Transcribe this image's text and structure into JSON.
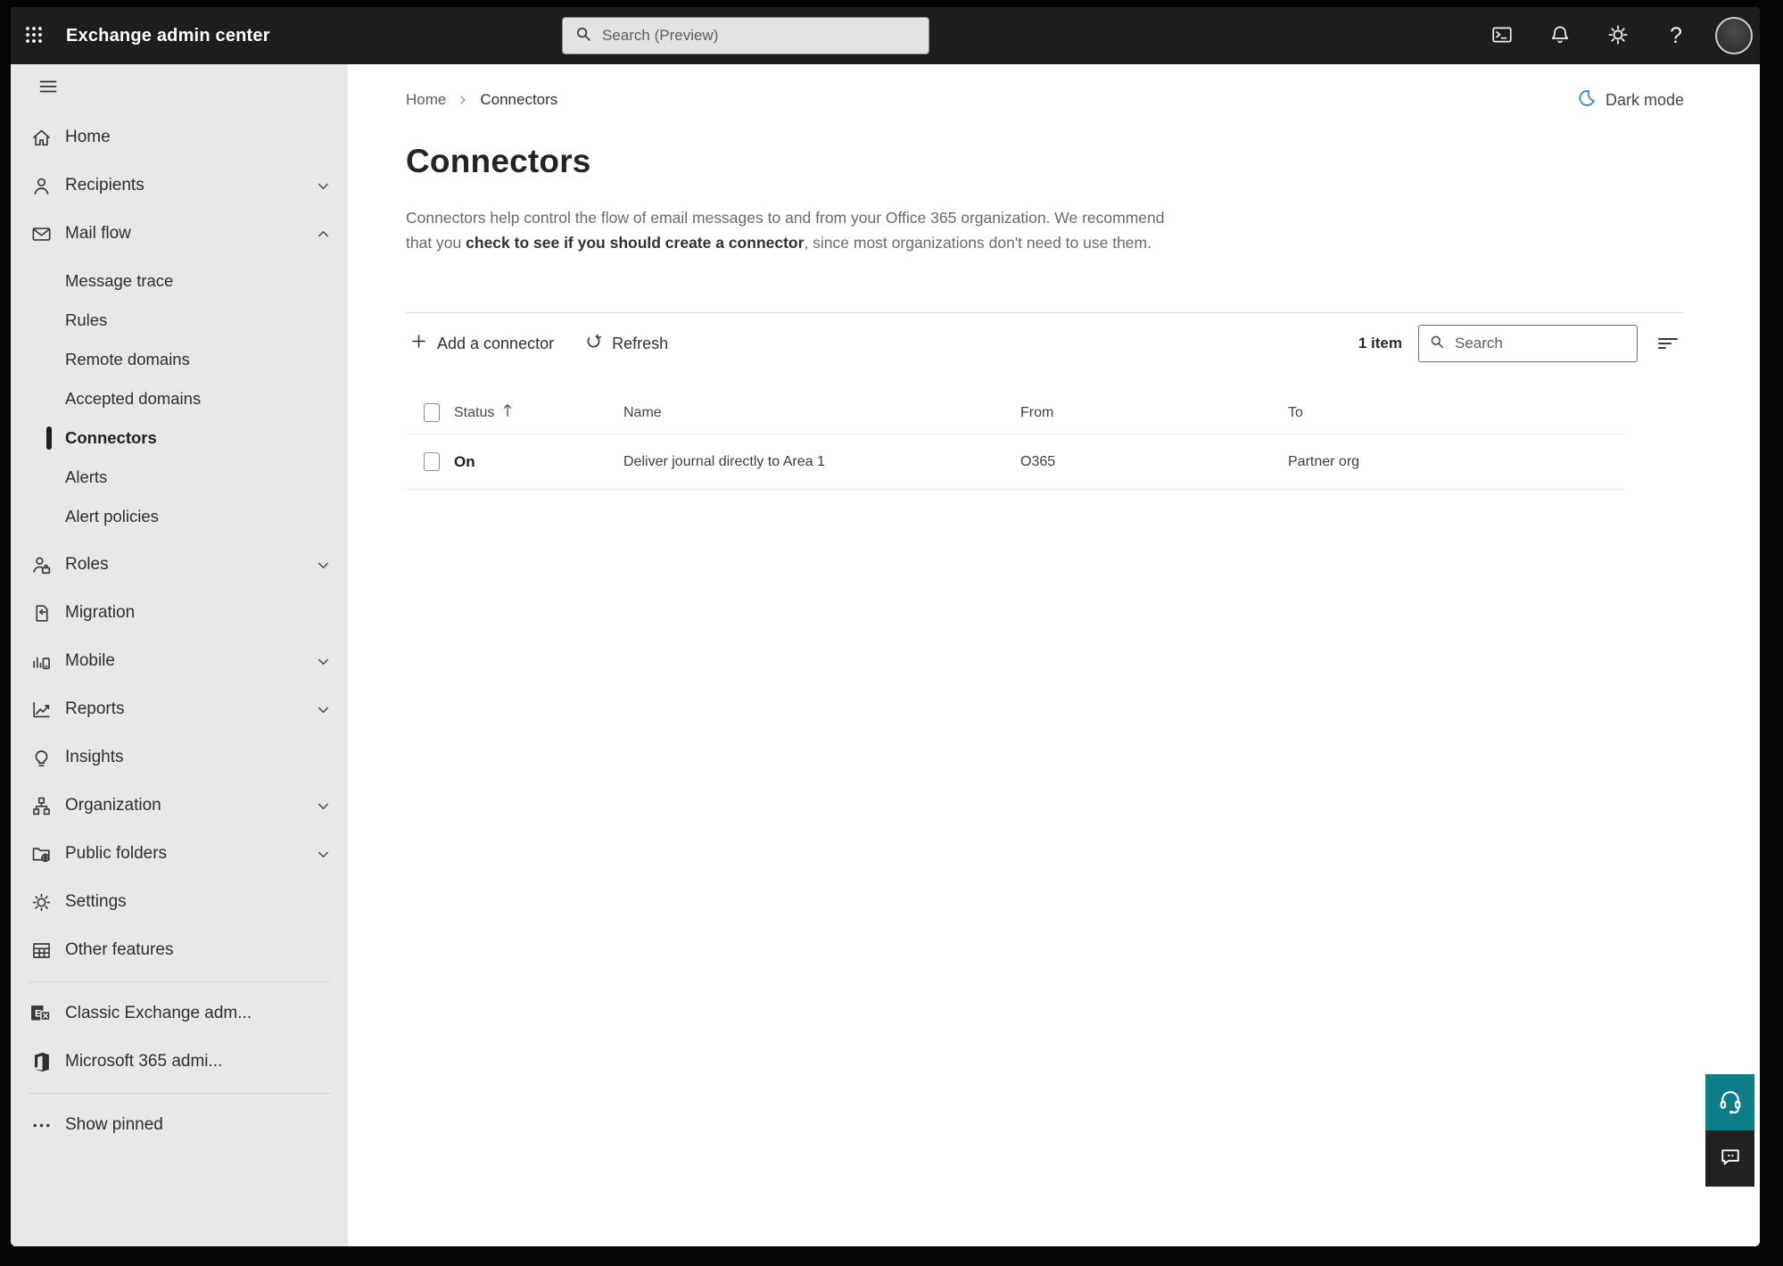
{
  "topbar": {
    "title": "Exchange admin center",
    "search_placeholder": "Search (Preview)",
    "icons": [
      "terminal-icon",
      "bell-icon",
      "gear-icon",
      "help-icon",
      "avatar"
    ],
    "help_glyph": "?"
  },
  "sidebar": {
    "items": [
      {
        "label": "Home",
        "icon": "home",
        "type": "item"
      },
      {
        "label": "Recipients",
        "icon": "person",
        "type": "item",
        "chevron": "down"
      },
      {
        "label": "Mail flow",
        "icon": "mail",
        "type": "item",
        "chevron": "up"
      },
      {
        "label": "Message trace",
        "type": "sub"
      },
      {
        "label": "Rules",
        "type": "sub"
      },
      {
        "label": "Remote domains",
        "type": "sub"
      },
      {
        "label": "Accepted domains",
        "type": "sub"
      },
      {
        "label": "Connectors",
        "type": "sub",
        "selected": true
      },
      {
        "label": "Alerts",
        "type": "sub"
      },
      {
        "label": "Alert policies",
        "type": "sub"
      },
      {
        "label": "Roles",
        "icon": "roles",
        "type": "item",
        "chevron": "down"
      },
      {
        "label": "Migration",
        "icon": "migration",
        "type": "item"
      },
      {
        "label": "Mobile",
        "icon": "mobile",
        "type": "item",
        "chevron": "down"
      },
      {
        "label": "Reports",
        "icon": "reports",
        "type": "item",
        "chevron": "down"
      },
      {
        "label": "Insights",
        "icon": "insights",
        "type": "item"
      },
      {
        "label": "Organization",
        "icon": "organization",
        "type": "item",
        "chevron": "down"
      },
      {
        "label": "Public folders",
        "icon": "folders",
        "type": "item",
        "chevron": "down"
      },
      {
        "label": "Settings",
        "icon": "gear",
        "type": "item"
      },
      {
        "label": "Other features",
        "icon": "grid",
        "type": "item"
      },
      {
        "label": "Classic Exchange adm...",
        "icon": "exchange",
        "type": "item",
        "divider_before": true
      },
      {
        "label": "Microsoft 365 admi...",
        "icon": "m365",
        "type": "item"
      },
      {
        "label": "Show pinned",
        "icon": "dots",
        "type": "item",
        "divider_before": true
      }
    ]
  },
  "page": {
    "breadcrumb": [
      "Home",
      "Connectors"
    ],
    "dark_mode_label": "Dark mode",
    "title": "Connectors",
    "description": {
      "part1": "Connectors help control the flow of email messages to and from your Office 365 organization. We recommend that you ",
      "link": "check to see if you should create a connector",
      "part2": ", since most organizations don't need to use them."
    }
  },
  "toolbar": {
    "add_label": "Add a connector",
    "refresh_label": "Refresh",
    "item_count": "1 item",
    "search_placeholder": "Search"
  },
  "table": {
    "columns": [
      {
        "key": "status",
        "label": "Status",
        "sorted": "asc"
      },
      {
        "key": "name",
        "label": "Name"
      },
      {
        "key": "from",
        "label": "From"
      },
      {
        "key": "to",
        "label": "To"
      }
    ],
    "rows": [
      {
        "status": "On",
        "name": "Deliver journal directly to Area 1",
        "from": "O365",
        "to": "Partner org"
      }
    ]
  },
  "colors": {
    "topbar_bg": "#1d1d1d",
    "sidebar_bg": "#e9e8e7",
    "help_teal": "#0d7d87",
    "moon_blue": "#3586d3"
  }
}
